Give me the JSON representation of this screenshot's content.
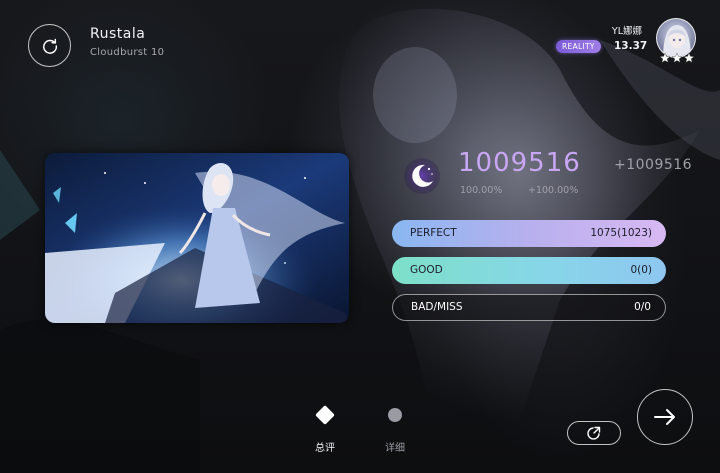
{
  "song": {
    "title": "Rustala",
    "difficulty": "Cloudburst 10"
  },
  "player": {
    "name": "YL娜娜",
    "rank_badge": "REALITY",
    "rks": "13.37",
    "avatar_stars": 3
  },
  "result": {
    "grade_icon": "crescent-moon-icon",
    "score": "1009516",
    "score_delta": "+1009516",
    "accuracy": "100.00%",
    "accuracy_delta": "+100.00%"
  },
  "judgements": [
    {
      "label": "PERFECT",
      "value": "1075(1023)"
    },
    {
      "label": "GOOD",
      "value": "0(0)"
    },
    {
      "label": "BAD/MISS",
      "value": "0/0"
    }
  ],
  "tabs": [
    {
      "label": "总评",
      "icon": "diamond-icon",
      "active": true
    },
    {
      "label": "详细",
      "icon": "dot-icon",
      "active": false
    }
  ],
  "buttons": {
    "retry_icon": "retry-icon",
    "share_icon": "share-icon",
    "next_icon": "arrow-right-icon"
  },
  "colors": {
    "score": "#c9a6f4",
    "perfect_start": "#8ab7f0",
    "perfect_end": "#d8b8f2",
    "good_start": "#7de0c8",
    "good_end": "#8ec6f0",
    "badge": "#8a66de"
  }
}
